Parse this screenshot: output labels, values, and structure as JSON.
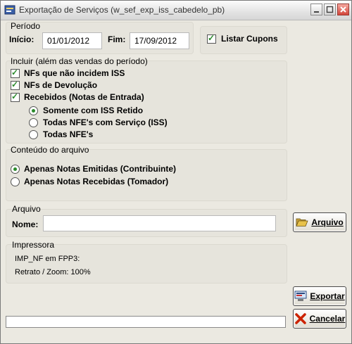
{
  "window": {
    "title": "Exportação de Serviços (w_sef_exp_iss_cabedelo_pb)"
  },
  "periodo": {
    "title": "Período",
    "inicio_label": "Início:",
    "inicio_value": "01/01/2012",
    "fim_label": "Fim:",
    "fim_value": "17/09/2012",
    "listar_cupons_label": "Listar Cupons",
    "listar_cupons_checked": true
  },
  "incluir": {
    "title": "Incluir (além das vendas do período)",
    "nfs_nao_iss": "NFs que não incidem ISS",
    "nfs_devolucao": "NFs de Devolução",
    "recebidos": "Recebidos (Notas de Entrada)",
    "radio_somente_iss": "Somente com ISS Retido",
    "radio_todas_servico": "Todas NFE's com Serviço (ISS)",
    "radio_todas_nfe": "Todas NFE's"
  },
  "conteudo": {
    "title": "Conteúdo do arquivo",
    "radio_emitidas": "Apenas Notas Emitidas (Contribuinte)",
    "radio_recebidas": "Apenas Notas Recebidas (Tomador)"
  },
  "arquivo": {
    "title": "Arquivo",
    "nome_label": "Nome:",
    "nome_value": "",
    "button_label": "Arquivo"
  },
  "impressora": {
    "title": "Impressora",
    "line1": "IMP_NF em FPP3:",
    "line2": "Retrato / Zoom: 100%"
  },
  "buttons": {
    "exportar": "Exportar",
    "cancelar": "Cancelar"
  },
  "colors": {
    "check_green": "#2a8a2a",
    "cancel_red": "#cc2200",
    "folder_yellow": "#e8c24a"
  }
}
